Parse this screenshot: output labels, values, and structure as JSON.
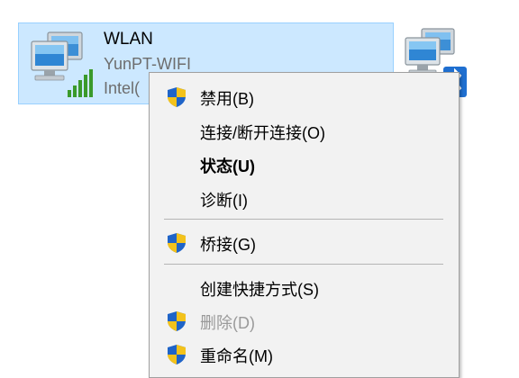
{
  "adapter": {
    "name": "WLAN",
    "ssid": "YunPT-WIFI",
    "device": "Intel("
  },
  "context_menu": {
    "items": [
      {
        "label": "禁用(B)",
        "icon": "uac-shield-icon"
      },
      {
        "label": "连接/断开连接(O)"
      },
      {
        "label": "状态(U)"
      },
      {
        "label": "诊断(I)"
      },
      {
        "label": "桥接(G)",
        "icon": "uac-shield-icon"
      },
      {
        "label": "创建快捷方式(S)"
      },
      {
        "label": "删除(D)",
        "icon": "uac-shield-icon",
        "disabled": true
      },
      {
        "label": "重命名(M)",
        "icon": "uac-shield-icon"
      }
    ]
  },
  "colors": {
    "selection_bg": "#cce8ff",
    "selection_border": "#99d1ff",
    "menu_bg": "#f2f2f2",
    "disabled_text": "#9a9a9a"
  }
}
